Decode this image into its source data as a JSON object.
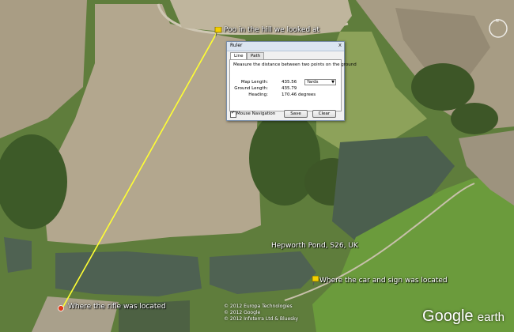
{
  "placemarks": {
    "hill": "Poo in the hill we looked at",
    "rifle": "Where the rifle was located",
    "car": "Where the car and sign was located",
    "pond": "Hepworth Pond, S26, UK"
  },
  "ruler": {
    "title": "Ruler",
    "close": "x",
    "tabs": [
      "Line",
      "Path"
    ],
    "description": "Measure the distance between two points on the ground",
    "map_length_label": "Map Length:",
    "map_length_value": "435.56",
    "unit": "Yards",
    "ground_length_label": "Ground Length:",
    "ground_length_value": "435.79",
    "heading_label": "Heading:",
    "heading_value": "170.46 degrees",
    "mouse_nav_label": "Mouse Navigation",
    "save_label": "Save",
    "clear_label": "Clear"
  },
  "copyright": {
    "line1": "© 2012 Europa Technologies",
    "line2": "© 2012 Google",
    "line3": "© 2012 Infoterra Ltd & Bluesky"
  },
  "logo": {
    "google": "Google",
    "earth": "earth"
  },
  "colors": {
    "measure_line": "#ffff33",
    "pin": "#f4d000"
  }
}
